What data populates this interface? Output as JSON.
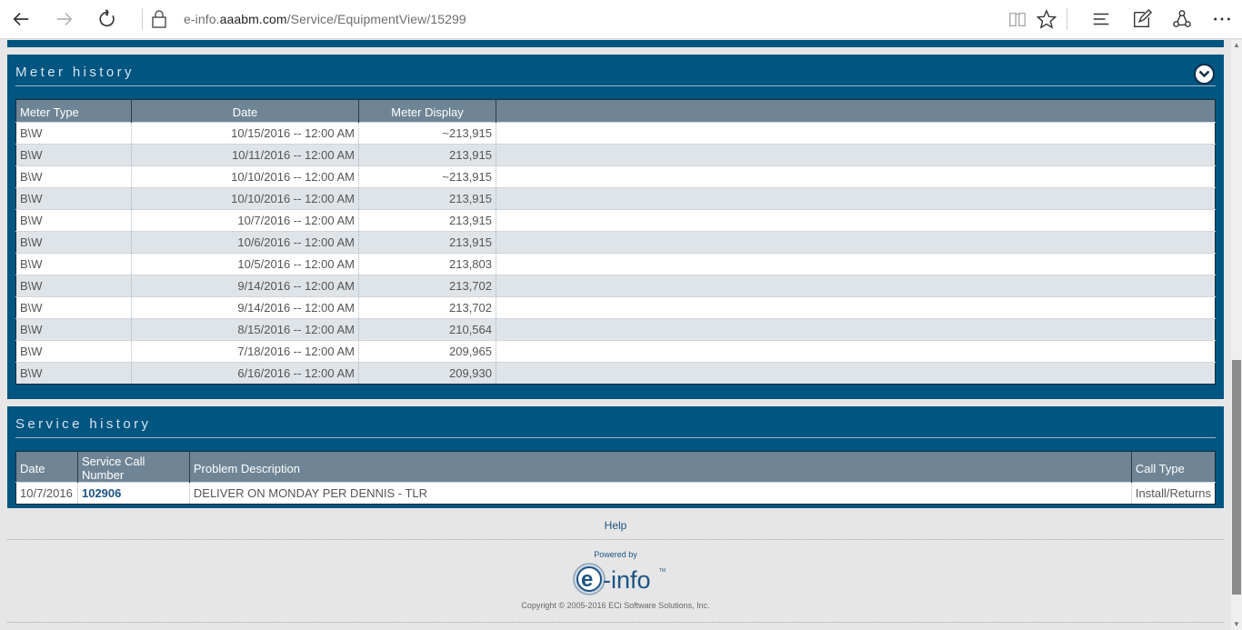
{
  "browser": {
    "url_prefix": "e-info.",
    "url_domain": "aaabm.com",
    "url_path": "/Service/EquipmentView/15299"
  },
  "meter_history": {
    "title": "Meter history",
    "columns": [
      "Meter Type",
      "Date",
      "Meter Display"
    ],
    "rows": [
      {
        "type": "B\\W",
        "date": "10/15/2016 -- 12:00 AM",
        "display": "~213,915"
      },
      {
        "type": "B\\W",
        "date": "10/11/2016 -- 12:00 AM",
        "display": "213,915"
      },
      {
        "type": "B\\W",
        "date": "10/10/2016 -- 12:00 AM",
        "display": "~213,915"
      },
      {
        "type": "B\\W",
        "date": "10/10/2016 -- 12:00 AM",
        "display": "213,915"
      },
      {
        "type": "B\\W",
        "date": "10/7/2016 -- 12:00 AM",
        "display": "213,915"
      },
      {
        "type": "B\\W",
        "date": "10/6/2016 -- 12:00 AM",
        "display": "213,915"
      },
      {
        "type": "B\\W",
        "date": "10/5/2016 -- 12:00 AM",
        "display": "213,803"
      },
      {
        "type": "B\\W",
        "date": "9/14/2016 -- 12:00 AM",
        "display": "213,702"
      },
      {
        "type": "B\\W",
        "date": "9/14/2016 -- 12:00 AM",
        "display": "213,702"
      },
      {
        "type": "B\\W",
        "date": "8/15/2016 -- 12:00 AM",
        "display": "210,564"
      },
      {
        "type": "B\\W",
        "date": "7/18/2016 -- 12:00 AM",
        "display": "209,965"
      },
      {
        "type": "B\\W",
        "date": "6/16/2016 -- 12:00 AM",
        "display": "209,930"
      }
    ]
  },
  "service_history": {
    "title": "Service history",
    "columns": [
      "Date",
      "Service Call Number",
      "Problem Description",
      "Call Type"
    ],
    "rows": [
      {
        "date": "10/7/2016",
        "call_number": "102906",
        "description": "DELIVER ON MONDAY PER DENNIS - TLR",
        "call_type": "Install/Returns"
      }
    ]
  },
  "footer": {
    "help": "Help",
    "powered_by": "Powered by",
    "logo_text": "e-info",
    "copyright": "Copyright © 2005-2016 ECi Software Solutions, Inc."
  },
  "colors": {
    "panel": "#005581",
    "header": "#6f8595",
    "link": "#1b5486"
  },
  "icons": [
    "back-icon",
    "forward-icon",
    "refresh-icon",
    "lock-icon",
    "reading-view-icon",
    "favorite-star-icon",
    "hub-icon",
    "web-note-icon",
    "share-icon",
    "more-icon",
    "chevron-down-icon"
  ]
}
